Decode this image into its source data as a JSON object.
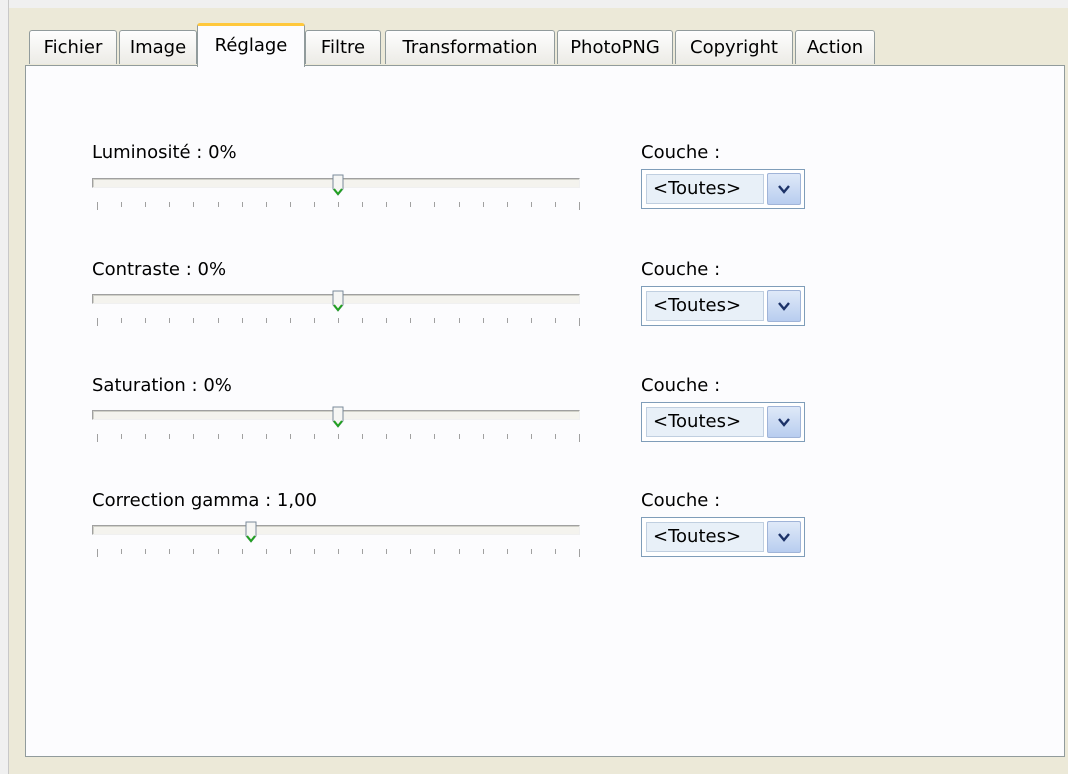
{
  "tabs": [
    {
      "label": "Fichier",
      "active": false
    },
    {
      "label": "Image",
      "active": false
    },
    {
      "label": "Réglage",
      "active": true
    },
    {
      "label": "Filtre",
      "active": false
    },
    {
      "label": "Transformation",
      "active": false
    },
    {
      "label": "PhotoPNG",
      "active": false
    },
    {
      "label": "Copyright",
      "active": false
    },
    {
      "label": "Action",
      "active": false
    }
  ],
  "adjustments": [
    {
      "label": "Luminosité : 0%",
      "level": 0.5,
      "layer_label": "Couche :",
      "layer_value": "<Toutes>"
    },
    {
      "label": "Contraste : 0%",
      "level": 0.5,
      "layer_label": "Couche :",
      "layer_value": "<Toutes>"
    },
    {
      "label": "Saturation : 0%",
      "level": 0.5,
      "layer_label": "Couche :",
      "layer_value": "<Toutes>"
    },
    {
      "label": "Correction gamma : 1,00",
      "level": 0.32,
      "layer_label": "Couche :",
      "layer_value": "<Toutes>"
    }
  ],
  "icons": {
    "combo_arrow": "chevron-down-icon",
    "slider_thumb": "slider-thumb"
  },
  "colors": {
    "active_tab_accent": "#ffc83c",
    "thumb_accent": "#21a121",
    "panel_bg": "#fcfcfe"
  }
}
